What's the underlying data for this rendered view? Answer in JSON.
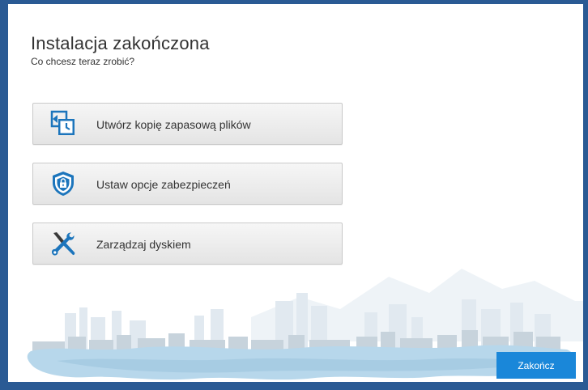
{
  "dialog": {
    "title": "Instalacja zakończona",
    "subtitle": "Co chcesz teraz zrobić?"
  },
  "actions": [
    {
      "label": "Utwórz kopię zapasową plików",
      "icon": "backup-clock-icon"
    },
    {
      "label": "Ustaw opcje zabezpieczeń",
      "icon": "shield-lock-icon"
    },
    {
      "label": "Zarządzaj dyskiem",
      "icon": "tools-icon"
    }
  ],
  "footer": {
    "finish_label": "Zakończ"
  },
  "colors": {
    "accent": "#1a87d9",
    "window_border": "#2a5a94",
    "icon_blue": "#1c75bc",
    "water": "#b7d7eb"
  }
}
